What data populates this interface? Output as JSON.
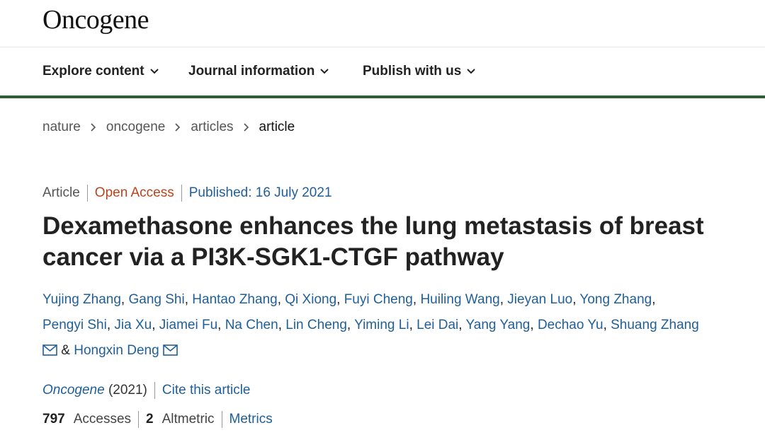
{
  "header": {
    "logo": "Oncogene"
  },
  "nav": {
    "items": [
      {
        "label": "Explore content"
      },
      {
        "label": "Journal information"
      },
      {
        "label": "Publish with us"
      }
    ]
  },
  "breadcrumb": [
    "nature",
    "oncogene",
    "articles",
    "article"
  ],
  "meta": {
    "type": "Article",
    "access": "Open Access",
    "published": "Published: 16 July 2021"
  },
  "article": {
    "title_line1": "Dexamethasone enhances the lung metastasis of breast",
    "title_line2": "cancer via a PI3K-SGK1-CTGF pathway",
    "authors": [
      "Yujing Zhang",
      "Gang Shi",
      "Hantao Zhang",
      "Qi Xiong",
      "Fuyi Cheng",
      "Huiling Wang",
      "Jieyan Luo",
      "Yong Zhang",
      "Pengyi Shi",
      "Jia Xu",
      "Jiamei Fu",
      "Na Chen",
      "Lin Cheng",
      "Yiming Li",
      "Lei Dai",
      "Yang Yang",
      "Dechao Yu",
      "Shuang Zhang",
      "Hongxin Deng"
    ],
    "ampersand": "&"
  },
  "citation": {
    "journal": "Oncogene",
    "year": " (2021)",
    "cite_label": "Cite this article"
  },
  "metrics": {
    "accesses_count": "797",
    "accesses_label": "Accesses",
    "altmetric_count": "2",
    "altmetric_label": "Altmetric",
    "metrics_link": "Metrics"
  },
  "colors": {
    "link": "#1f5f99",
    "open_access": "#b8451d",
    "nav_rule": "#2e5f2e"
  }
}
